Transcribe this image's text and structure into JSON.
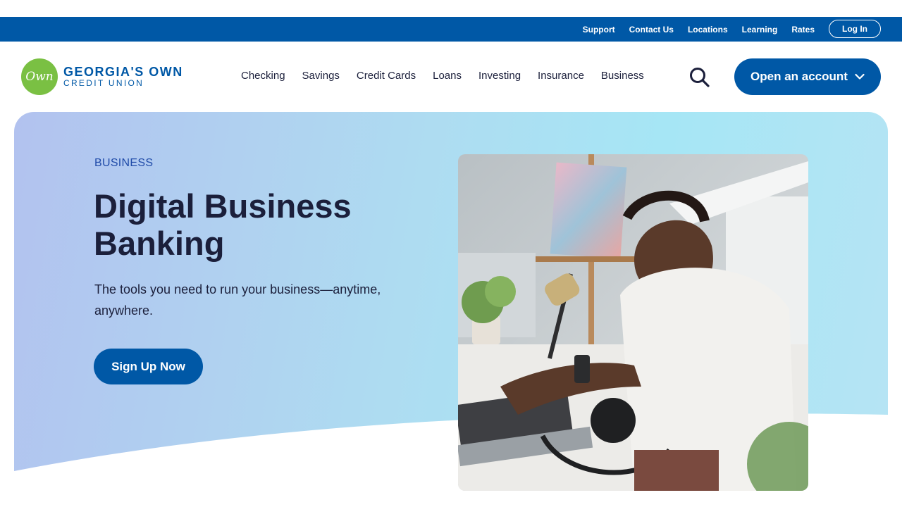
{
  "utility_nav": {
    "links": [
      "Support",
      "Contact Us",
      "Locations",
      "Learning",
      "Rates"
    ],
    "login_label": "Log In"
  },
  "brand": {
    "logo_mark": "Own",
    "name_line1": "GEORGIA'S OWN",
    "name_line2": "CREDIT UNION"
  },
  "main_nav": {
    "items": [
      "Checking",
      "Savings",
      "Credit Cards",
      "Loans",
      "Investing",
      "Insurance",
      "Business"
    ],
    "search_icon": "search-icon",
    "open_account_label": "Open an account",
    "open_account_icon": "chevron-down-icon"
  },
  "hero": {
    "eyebrow": "BUSINESS",
    "title": "Digital Business Banking",
    "subtitle": "The tools you need to run your business—anytime, anywhere.",
    "cta_label": "Sign Up Now"
  },
  "colors": {
    "primary_blue": "#0058a6",
    "logo_green": "#7ac043",
    "heading_navy": "#1b1f3b",
    "eyebrow_blue": "#1f4aa8",
    "hero_gradient_start": "#b2c2ef",
    "hero_gradient_end": "#a6e6f5"
  }
}
